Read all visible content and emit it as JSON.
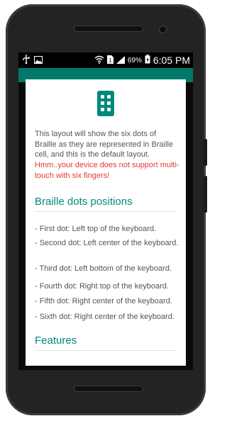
{
  "status_bar": {
    "battery_percent": "69%",
    "time": "6:05 PM"
  },
  "dialog": {
    "intro_text": "This layout will show the six dots of Braille as they are represented in Braille cell, and this is the default layout.",
    "warning_text": "Hmm..your device does not support multi-touch with six fingers!",
    "section_dots_title": "Braille dots positions",
    "dot_items": [
      "- First dot: Left top of the keyboard.",
      "- Second dot: Left center of the keyboard.",
      "- Third dot: Left bottom of the keyboard.",
      "- Fourth dot: Right top of the keyboard.",
      "- Fifth dot: Right center of the keyboard.",
      "- Sixth dot: Right center of the keyboard."
    ],
    "section_features_title": "Features"
  },
  "colors": {
    "accent": "#00897b",
    "appbar": "#00796b",
    "warning": "#e53935"
  }
}
